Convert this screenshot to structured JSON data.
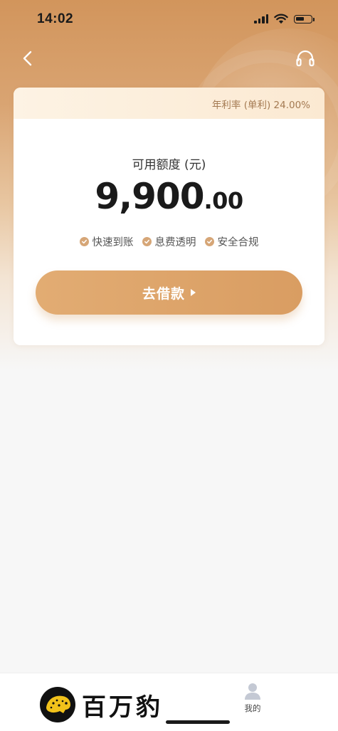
{
  "status_bar": {
    "time": "14:02"
  },
  "nav": {
    "back_icon": "chevron-left-icon",
    "support_icon": "headset-icon"
  },
  "card": {
    "rate_text": "年利率 (单利) 24.00%",
    "limit_label": "可用额度 (元)",
    "amount_integer": "9,900",
    "amount_decimal": ".00",
    "features": [
      {
        "label": "快速到账",
        "icon": "check-circle-icon"
      },
      {
        "label": "息费透明",
        "icon": "check-circle-icon"
      },
      {
        "label": "安全合规",
        "icon": "check-circle-icon"
      }
    ],
    "borrow_button_label": "去借款"
  },
  "tab_bar": {
    "me_label": "我的",
    "me_icon": "person-icon"
  },
  "watermark": {
    "text": "百万豹",
    "logo": "leopard-logo"
  },
  "colors": {
    "accent": "#d99d62",
    "hero_top": "#d2955c",
    "rate_text": "#a47a52",
    "check": "#d6a677"
  }
}
